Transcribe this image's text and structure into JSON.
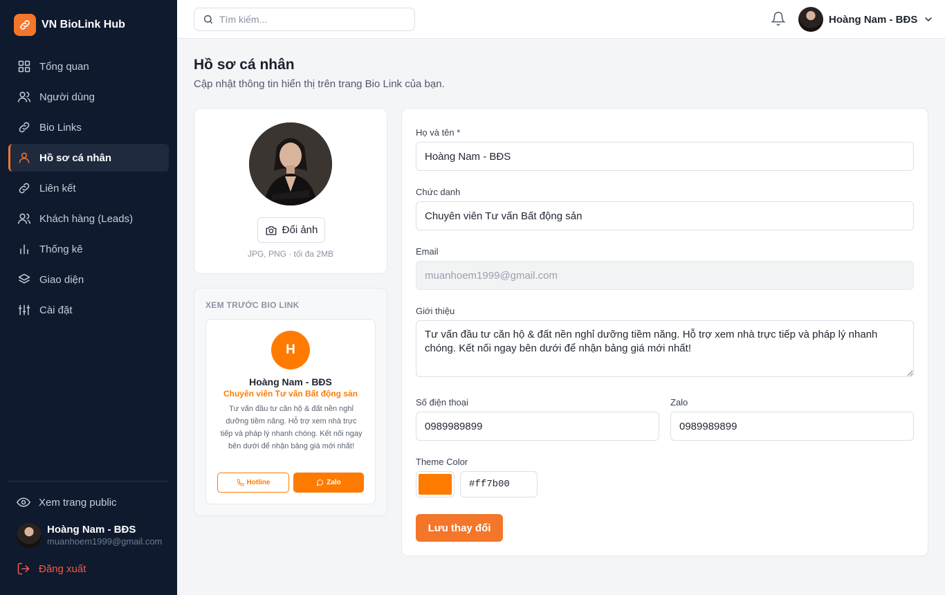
{
  "brand": {
    "name": "VN BioLink Hub",
    "icon": "link-icon",
    "accent": "#f4762a"
  },
  "sidebar": {
    "items": [
      {
        "label": "Tổng quan",
        "icon": "grid-icon"
      },
      {
        "label": "Người dùng",
        "icon": "users-icon"
      },
      {
        "label": "Bio Links",
        "icon": "link-icon"
      },
      {
        "label": "Hồ sơ cá nhân",
        "icon": "user-icon",
        "active": true
      },
      {
        "label": "Liên kết",
        "icon": "link-icon"
      },
      {
        "label": "Khách hàng (Leads)",
        "icon": "users-icon"
      },
      {
        "label": "Thống kê",
        "icon": "bar-chart-icon"
      },
      {
        "label": "Giao diện",
        "icon": "layers-icon"
      },
      {
        "label": "Cài đặt",
        "icon": "sliders-icon"
      }
    ],
    "public_link": "Xem trang public",
    "user": {
      "name": "Hoàng Nam - BĐS",
      "email": "muanhoem1999@gmail.com"
    },
    "logout": "Đăng xuất"
  },
  "topbar": {
    "search_placeholder": "Tìm kiếm...",
    "user_name": "Hoàng Nam - BĐS"
  },
  "page": {
    "title": "Hồ sơ cá nhân",
    "subtitle": "Cập nhật thông tin hiển thị trên trang Bio Link của bạn."
  },
  "avatar_card": {
    "change_label": "Đổi ảnh",
    "hint": "JPG, PNG · tối đa 2MB"
  },
  "preview": {
    "label": "XEM TRƯỚC BIO LINK",
    "initial": "H",
    "name": "Hoàng Nam - BĐS",
    "title": "Chuyên viên Tư vấn Bất động sản",
    "bio": "Tư vấn đầu tư căn hộ & đất nền nghỉ dưỡng tiềm năng. Hỗ trợ xem nhà trực tiếp và pháp lý nhanh chóng. Kết nối ngay bên dưới để nhận bảng giá mới nhất!",
    "hotline_label": "Hotline",
    "zalo_label": "Zalo"
  },
  "form": {
    "name_label": "Họ và tên *",
    "name_value": "Hoàng Nam - BĐS",
    "title_label": "Chức danh",
    "title_value": "Chuyên viên Tư vấn Bất động sản",
    "email_label": "Email",
    "email_value": "muanhoem1999@gmail.com",
    "bio_label": "Giới thiệu",
    "bio_value": "Tư vấn đầu tư căn hộ & đất nền nghỉ dưỡng tiềm năng. Hỗ trợ xem nhà trực tiếp và pháp lý nhanh chóng. Kết nối ngay bên dưới để nhận bảng giá mới nhất!",
    "phone_label": "Số điện thoại",
    "phone_value": "0989989899",
    "zalo_label": "Zalo",
    "zalo_value": "0989989899",
    "theme_label": "Theme Color",
    "theme_value": "#ff7b00",
    "save_label": "Lưu thay đổi"
  }
}
